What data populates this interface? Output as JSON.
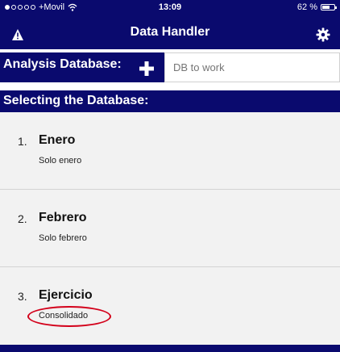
{
  "status": {
    "carrier": "+Movil",
    "time": "13:09",
    "battery": "62 %",
    "battery_level": 0.62
  },
  "navbar": {
    "title": "Data Handler",
    "left_icon": "warning-icon",
    "right_icon": "gear-icon"
  },
  "analysis": {
    "label": "Analysis Database:",
    "plus_icon": "plus-icon",
    "input_placeholder": "DB to work",
    "input_value": ""
  },
  "section": {
    "title": "Selecting the Database:"
  },
  "items": [
    {
      "number": "1.",
      "title": "Enero",
      "subtitle": "Solo enero"
    },
    {
      "number": "2.",
      "title": "Febrero",
      "subtitle": "Solo febrero"
    },
    {
      "number": "3.",
      "title": "Ejercicio",
      "subtitle": "Consolidado"
    }
  ],
  "colors": {
    "navy": "#0a0a6e",
    "list_bg": "#f2f2f2",
    "highlight": "#d3001a"
  }
}
